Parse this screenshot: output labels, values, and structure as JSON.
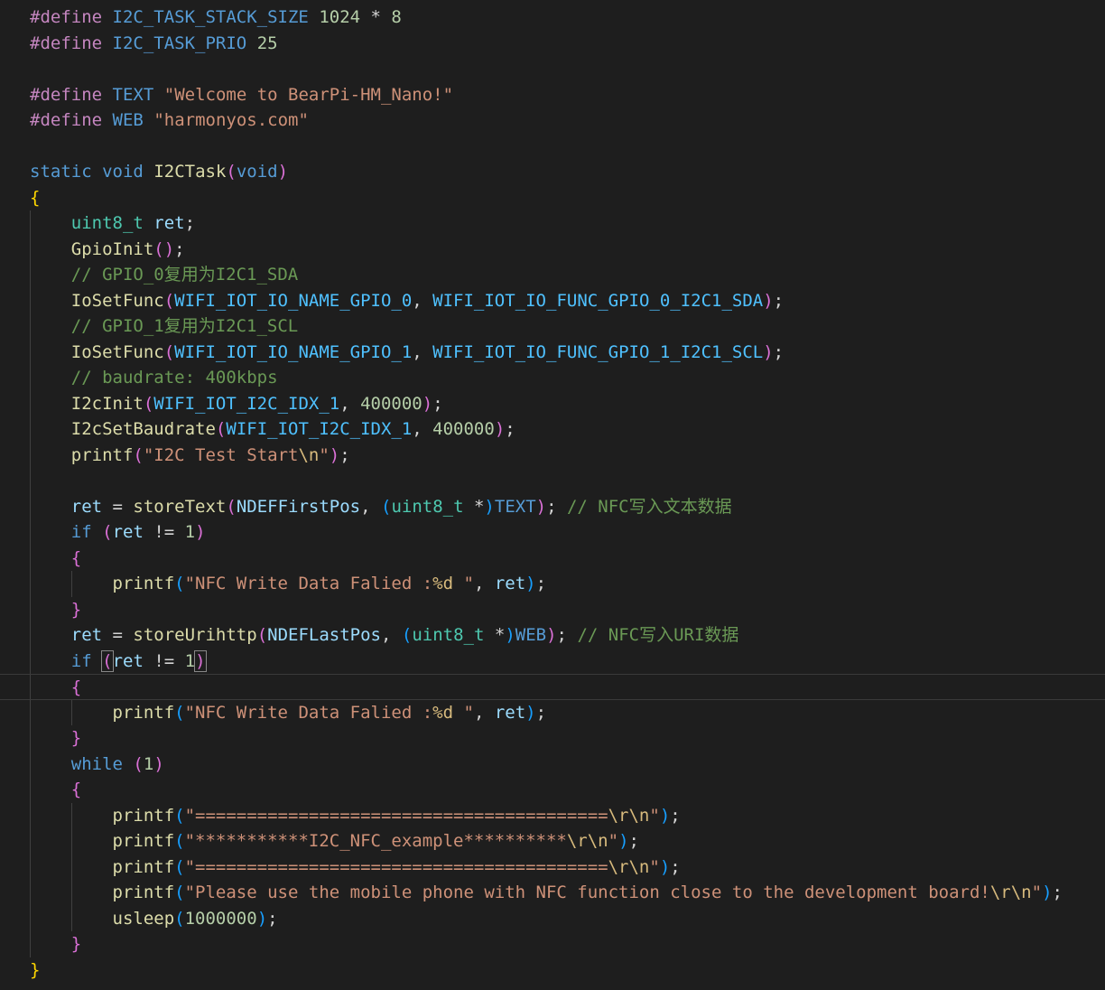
{
  "editor": {
    "colors": {
      "background": "#1e1e1e",
      "keyword": "#569cd6",
      "preprocessor": "#c586c0",
      "number": "#b5cea8",
      "string": "#ce9178",
      "escape": "#d7ba7d",
      "function": "#dcdcaa",
      "type": "#4ec9b0",
      "variable": "#9cdcfe",
      "constant": "#4fc1ff",
      "comment": "#6a9955",
      "bracket_level_1": "#ffd700",
      "bracket_level_2": "#da70d6",
      "bracket_level_3": "#179fff"
    },
    "current_line": 26,
    "lines": [
      [
        [
          "pp",
          "#define"
        ],
        [
          "punc",
          " "
        ],
        [
          "macro",
          "I2C_TASK_STACK_SIZE"
        ],
        [
          "punc",
          " "
        ],
        [
          "num",
          "1024"
        ],
        [
          "punc",
          " * "
        ],
        [
          "num",
          "8"
        ]
      ],
      [
        [
          "pp",
          "#define"
        ],
        [
          "punc",
          " "
        ],
        [
          "macro",
          "I2C_TASK_PRIO"
        ],
        [
          "punc",
          " "
        ],
        [
          "num",
          "25"
        ]
      ],
      [],
      [
        [
          "pp",
          "#define"
        ],
        [
          "punc",
          " "
        ],
        [
          "macro",
          "TEXT"
        ],
        [
          "punc",
          " "
        ],
        [
          "str",
          "\"Welcome to BearPi-HM_Nano!\""
        ]
      ],
      [
        [
          "pp",
          "#define"
        ],
        [
          "punc",
          " "
        ],
        [
          "macro",
          "WEB"
        ],
        [
          "punc",
          " "
        ],
        [
          "str",
          "\"harmonyos.com\""
        ]
      ],
      [],
      [
        [
          "kw",
          "static"
        ],
        [
          "punc",
          " "
        ],
        [
          "kw",
          "void"
        ],
        [
          "punc",
          " "
        ],
        [
          "fn",
          "I2CTask"
        ],
        [
          "b2",
          "("
        ],
        [
          "kw",
          "void"
        ],
        [
          "b2",
          ")"
        ]
      ],
      [
        [
          "b1",
          "{"
        ]
      ],
      [
        [
          "punc",
          "    "
        ],
        [
          "type",
          "uint8_t"
        ],
        [
          "punc",
          " "
        ],
        [
          "var",
          "ret"
        ],
        [
          "punc",
          ";"
        ]
      ],
      [
        [
          "punc",
          "    "
        ],
        [
          "fn",
          "GpioInit"
        ],
        [
          "b2",
          "()"
        ],
        [
          "punc",
          ";"
        ]
      ],
      [
        [
          "punc",
          "    "
        ],
        [
          "cmt",
          "// GPIO_0复用为I2C1_SDA"
        ]
      ],
      [
        [
          "punc",
          "    "
        ],
        [
          "fn",
          "IoSetFunc"
        ],
        [
          "b2",
          "("
        ],
        [
          "const",
          "WIFI_IOT_IO_NAME_GPIO_0"
        ],
        [
          "punc",
          ", "
        ],
        [
          "const",
          "WIFI_IOT_IO_FUNC_GPIO_0_I2C1_SDA"
        ],
        [
          "b2",
          ")"
        ],
        [
          "punc",
          ";"
        ]
      ],
      [
        [
          "punc",
          "    "
        ],
        [
          "cmt",
          "// GPIO_1复用为I2C1_SCL"
        ]
      ],
      [
        [
          "punc",
          "    "
        ],
        [
          "fn",
          "IoSetFunc"
        ],
        [
          "b2",
          "("
        ],
        [
          "const",
          "WIFI_IOT_IO_NAME_GPIO_1"
        ],
        [
          "punc",
          ", "
        ],
        [
          "const",
          "WIFI_IOT_IO_FUNC_GPIO_1_I2C1_SCL"
        ],
        [
          "b2",
          ")"
        ],
        [
          "punc",
          ";"
        ]
      ],
      [
        [
          "punc",
          "    "
        ],
        [
          "cmt",
          "// baudrate: 400kbps"
        ]
      ],
      [
        [
          "punc",
          "    "
        ],
        [
          "fn",
          "I2cInit"
        ],
        [
          "b2",
          "("
        ],
        [
          "const",
          "WIFI_IOT_I2C_IDX_1"
        ],
        [
          "punc",
          ", "
        ],
        [
          "num",
          "400000"
        ],
        [
          "b2",
          ")"
        ],
        [
          "punc",
          ";"
        ]
      ],
      [
        [
          "punc",
          "    "
        ],
        [
          "fn",
          "I2cSetBaudrate"
        ],
        [
          "b2",
          "("
        ],
        [
          "const",
          "WIFI_IOT_I2C_IDX_1"
        ],
        [
          "punc",
          ", "
        ],
        [
          "num",
          "400000"
        ],
        [
          "b2",
          ")"
        ],
        [
          "punc",
          ";"
        ]
      ],
      [
        [
          "punc",
          "    "
        ],
        [
          "fn",
          "printf"
        ],
        [
          "b2",
          "("
        ],
        [
          "str",
          "\"I2C Test Start"
        ],
        [
          "esc",
          "\\n"
        ],
        [
          "str",
          "\""
        ],
        [
          "b2",
          ")"
        ],
        [
          "punc",
          ";"
        ]
      ],
      [],
      [
        [
          "punc",
          "    "
        ],
        [
          "var",
          "ret"
        ],
        [
          "punc",
          " = "
        ],
        [
          "fn",
          "storeText"
        ],
        [
          "b2",
          "("
        ],
        [
          "var",
          "NDEFFirstPos"
        ],
        [
          "punc",
          ", "
        ],
        [
          "b3",
          "("
        ],
        [
          "type",
          "uint8_t"
        ],
        [
          "punc",
          " *"
        ],
        [
          "b3",
          ")"
        ],
        [
          "macro",
          "TEXT"
        ],
        [
          "b2",
          ")"
        ],
        [
          "punc",
          "; "
        ],
        [
          "cmt",
          "// NFC写入文本数据"
        ]
      ],
      [
        [
          "punc",
          "    "
        ],
        [
          "kw",
          "if"
        ],
        [
          "punc",
          " "
        ],
        [
          "b2",
          "("
        ],
        [
          "var",
          "ret"
        ],
        [
          "punc",
          " != "
        ],
        [
          "num",
          "1"
        ],
        [
          "b2",
          ")"
        ]
      ],
      [
        [
          "punc",
          "    "
        ],
        [
          "b2",
          "{"
        ]
      ],
      [
        [
          "punc",
          "        "
        ],
        [
          "fn",
          "printf"
        ],
        [
          "b3",
          "("
        ],
        [
          "str",
          "\"NFC Write Data Falied :"
        ],
        [
          "esc",
          "%d"
        ],
        [
          "str",
          " \""
        ],
        [
          "punc",
          ", "
        ],
        [
          "var",
          "ret"
        ],
        [
          "b3",
          ")"
        ],
        [
          "punc",
          ";"
        ]
      ],
      [
        [
          "punc",
          "    "
        ],
        [
          "b2",
          "}"
        ]
      ],
      [
        [
          "punc",
          "    "
        ],
        [
          "var",
          "ret"
        ],
        [
          "punc",
          " = "
        ],
        [
          "fn",
          "storeUrihttp"
        ],
        [
          "b2",
          "("
        ],
        [
          "var",
          "NDEFLastPos"
        ],
        [
          "punc",
          ", "
        ],
        [
          "b3",
          "("
        ],
        [
          "type",
          "uint8_t"
        ],
        [
          "punc",
          " *"
        ],
        [
          "b3",
          ")"
        ],
        [
          "macro",
          "WEB"
        ],
        [
          "b2",
          ")"
        ],
        [
          "punc",
          "; "
        ],
        [
          "cmt",
          "// NFC写入URI数据"
        ]
      ],
      [
        [
          "punc",
          "    "
        ],
        [
          "kw",
          "if"
        ],
        [
          "punc",
          " "
        ],
        [
          "b2m",
          "("
        ],
        [
          "var",
          "ret"
        ],
        [
          "punc",
          " != "
        ],
        [
          "num",
          "1"
        ],
        [
          "b2m",
          ")"
        ]
      ],
      [
        [
          "punc",
          "    "
        ],
        [
          "b2",
          "{"
        ]
      ],
      [
        [
          "punc",
          "        "
        ],
        [
          "fn",
          "printf"
        ],
        [
          "b3",
          "("
        ],
        [
          "str",
          "\"NFC Write Data Falied :"
        ],
        [
          "esc",
          "%d"
        ],
        [
          "str",
          " \""
        ],
        [
          "punc",
          ", "
        ],
        [
          "var",
          "ret"
        ],
        [
          "b3",
          ")"
        ],
        [
          "punc",
          ";"
        ]
      ],
      [
        [
          "punc",
          "    "
        ],
        [
          "b2",
          "}"
        ]
      ],
      [
        [
          "punc",
          "    "
        ],
        [
          "kw",
          "while"
        ],
        [
          "punc",
          " "
        ],
        [
          "b2",
          "("
        ],
        [
          "num",
          "1"
        ],
        [
          "b2",
          ")"
        ]
      ],
      [
        [
          "punc",
          "    "
        ],
        [
          "b2",
          "{"
        ]
      ],
      [
        [
          "punc",
          "        "
        ],
        [
          "fn",
          "printf"
        ],
        [
          "b3",
          "("
        ],
        [
          "str",
          "\"========================================"
        ],
        [
          "esc",
          "\\r\\n"
        ],
        [
          "str",
          "\""
        ],
        [
          "b3",
          ")"
        ],
        [
          "punc",
          ";"
        ]
      ],
      [
        [
          "punc",
          "        "
        ],
        [
          "fn",
          "printf"
        ],
        [
          "b3",
          "("
        ],
        [
          "str",
          "\"***********I2C_NFC_example**********"
        ],
        [
          "esc",
          "\\r\\n"
        ],
        [
          "str",
          "\""
        ],
        [
          "b3",
          ")"
        ],
        [
          "punc",
          ";"
        ]
      ],
      [
        [
          "punc",
          "        "
        ],
        [
          "fn",
          "printf"
        ],
        [
          "b3",
          "("
        ],
        [
          "str",
          "\"========================================"
        ],
        [
          "esc",
          "\\r\\n"
        ],
        [
          "str",
          "\""
        ],
        [
          "b3",
          ")"
        ],
        [
          "punc",
          ";"
        ]
      ],
      [
        [
          "punc",
          "        "
        ],
        [
          "fn",
          "printf"
        ],
        [
          "b3",
          "("
        ],
        [
          "str",
          "\"Please use the mobile phone with NFC function close to the development board!"
        ],
        [
          "esc",
          "\\r\\n"
        ],
        [
          "str",
          "\""
        ],
        [
          "b3",
          ")"
        ],
        [
          "punc",
          ";"
        ]
      ],
      [
        [
          "punc",
          "        "
        ],
        [
          "fn",
          "usleep"
        ],
        [
          "b3",
          "("
        ],
        [
          "num",
          "1000000"
        ],
        [
          "b3",
          ")"
        ],
        [
          "punc",
          ";"
        ]
      ],
      [
        [
          "punc",
          "    "
        ],
        [
          "b2",
          "}"
        ]
      ],
      [
        [
          "b1",
          "}"
        ]
      ]
    ]
  }
}
